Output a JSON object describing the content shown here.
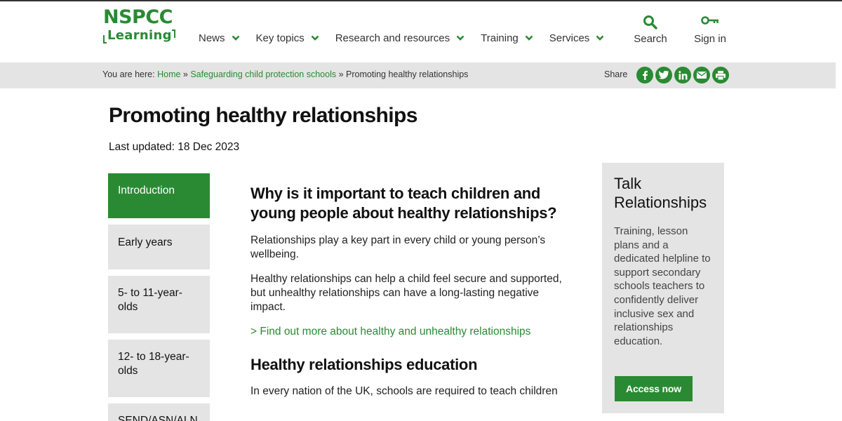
{
  "logo": {
    "line1": "NSPCC",
    "line2": "Learning"
  },
  "nav": [
    {
      "label": "News"
    },
    {
      "label": "Key topics"
    },
    {
      "label": "Research and resources"
    },
    {
      "label": "Training"
    },
    {
      "label": "Services"
    }
  ],
  "actions": {
    "search": "Search",
    "signin": "Sign in"
  },
  "breadcrumb": {
    "prefix": "You are here:",
    "home": "Home",
    "sep1": " » ",
    "section": "Safeguarding child protection schools",
    "sep2": " » ",
    "current": "Promoting healthy relationships"
  },
  "share": {
    "label": "Share",
    "icons": [
      "facebook-icon",
      "twitter-icon",
      "linkedin-icon",
      "email-icon",
      "print-icon"
    ]
  },
  "page": {
    "title": "Promoting healthy relationships",
    "updated": "Last updated: 18 Dec 2023"
  },
  "sidenav": [
    {
      "label": "Introduction"
    },
    {
      "label": "Early years"
    },
    {
      "label": "5- to 11-year-olds"
    },
    {
      "label": "12- to 18-year-olds"
    },
    {
      "label": "SEND/ASN/ALN"
    }
  ],
  "main": {
    "h1": "Why is it important to teach children and young people about healthy relationships?",
    "p1": "Relationships play a key part in every child or young person’s wellbeing.",
    "p2": "Healthy relationships can help a child feel secure and supported, but unhealthy relationships can have a long-lasting negative impact.",
    "link1": "> Find out more about healthy and unhealthy relationships",
    "h2": "Healthy relationships education",
    "p3": "In every nation of the UK, schools are required to teach children"
  },
  "aside": {
    "title": "Talk Relationships",
    "body": "Training, lesson plans and a dedicated helpline to support secondary schools teachers to confidently deliver inclusive sex and relationships education.",
    "button": "Access now"
  },
  "colors": {
    "brand": "#2a8a33",
    "panel": "#e4e4e4"
  }
}
